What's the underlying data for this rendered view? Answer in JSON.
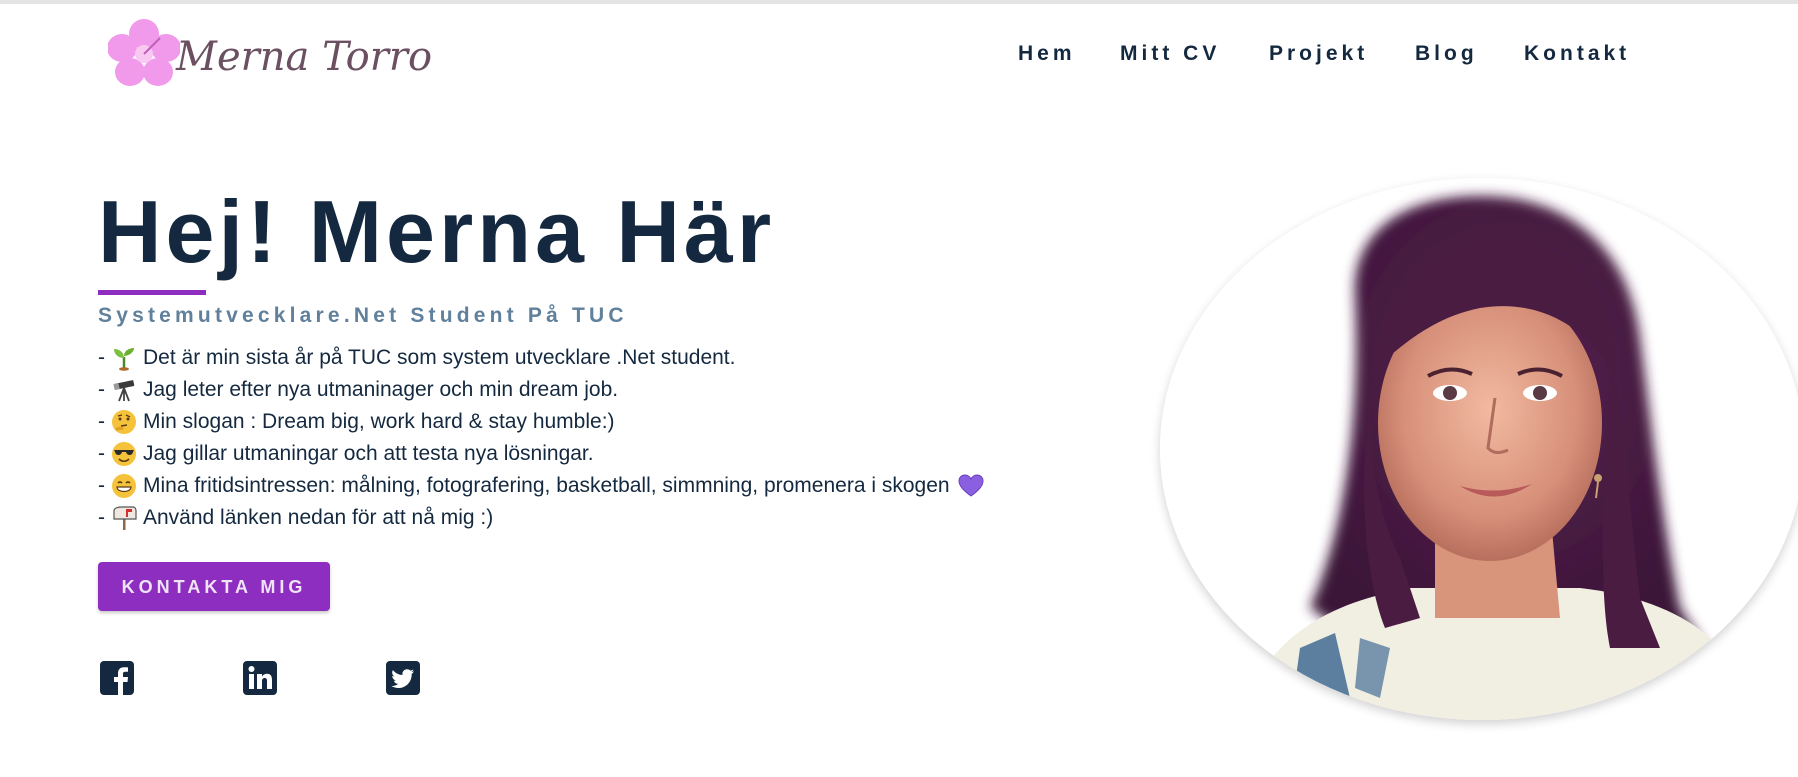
{
  "brand": {
    "logo_text": "Merna Torro",
    "colors": {
      "accent": "#8e2ec0",
      "navy": "#14293f",
      "subtitle": "#60809c",
      "logo_flower": "#f08ee8"
    }
  },
  "nav": {
    "items": [
      {
        "label": "Hem"
      },
      {
        "label": "Mitt CV"
      },
      {
        "label": "Projekt"
      },
      {
        "label": "Blog"
      },
      {
        "label": "Kontakt"
      }
    ]
  },
  "hero": {
    "title": "Hej! Merna Här",
    "subtitle": "Systemutvecklare.Net Student På TUC",
    "bullets": [
      {
        "prefix": "-",
        "icon": "seedling-icon",
        "text": "Det är min sista år på TUC som system utvecklare .Net student."
      },
      {
        "prefix": "-",
        "icon": "telescope-icon",
        "text": "Jag leter efter nya utmaninager och min dream job."
      },
      {
        "prefix": "-",
        "icon": "thinking-face-icon",
        "text": "Min slogan : Dream big, work hard & stay humble:)"
      },
      {
        "prefix": "-",
        "icon": "sunglasses-face-icon",
        "text": "Jag gillar utmaningar och att testa nya lösningar."
      },
      {
        "prefix": "-",
        "icon": "grinning-face-icon",
        "text": "Mina fritidsintressen: målning, fotografering, basketball, simmning, promenera i skogen",
        "trailing_icon": "purple-heart-icon"
      },
      {
        "prefix": "-",
        "icon": "mailbox-icon",
        "text": "Använd länken nedan för att nå mig :)"
      }
    ],
    "cta_label": "KONTAKTA MIG"
  },
  "social": [
    {
      "icon": "facebook-icon"
    },
    {
      "icon": "linkedin-icon"
    },
    {
      "icon": "twitter-icon"
    }
  ],
  "profile_photo": {
    "icon": "profile-photo"
  }
}
